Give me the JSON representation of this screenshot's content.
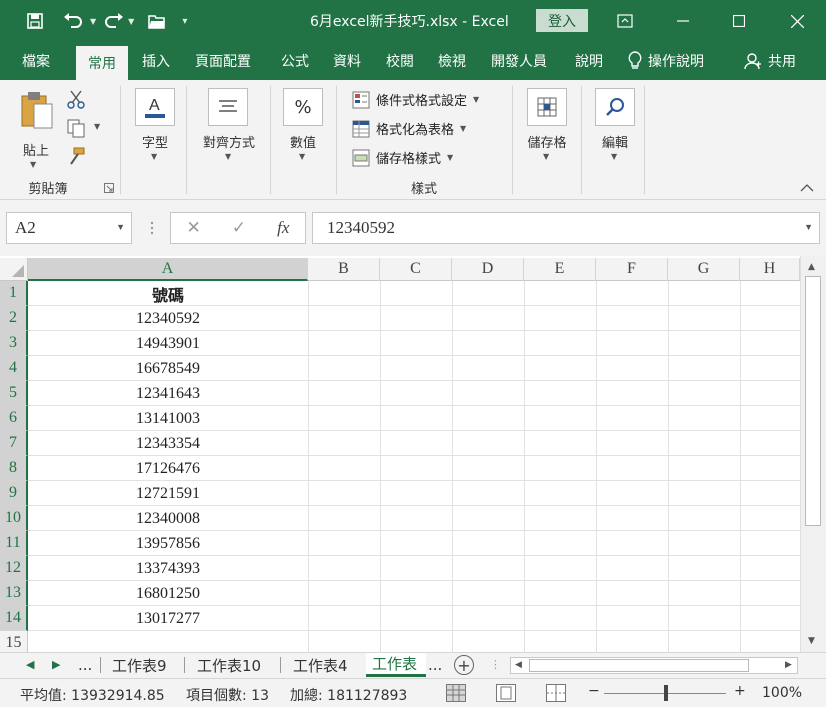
{
  "titlebar": {
    "filename": "6月excel新手技巧.xlsx  -  Excel",
    "login_label": "登入",
    "save_icon": "save-icon",
    "undo_icon": "undo-icon",
    "redo_icon": "redo-icon",
    "open_icon": "open-folder-icon"
  },
  "tabs": [
    "檔案",
    "常用",
    "插入",
    "頁面配置",
    "公式",
    "資料",
    "校閱",
    "檢視",
    "開發人員",
    "說明"
  ],
  "active_tab": "常用",
  "tell_me": "操作說明",
  "share": "共用",
  "ribbon": {
    "clipboard": {
      "paste": "貼上",
      "group": "剪貼簿"
    },
    "font": {
      "label": "字型"
    },
    "alignment": {
      "label": "對齊方式"
    },
    "number": {
      "label": "數值",
      "symbol": "%"
    },
    "styles": {
      "conditional": "條件式格式設定",
      "as_table": "格式化為表格",
      "cell_styles": "儲存格樣式",
      "group": "樣式"
    },
    "cells": {
      "label": "儲存格"
    },
    "editing": {
      "label": "編輯"
    }
  },
  "formula_bar": {
    "name_box": "A2",
    "fx": "fx",
    "value": "12340592"
  },
  "grid": {
    "columns": [
      "A",
      "B",
      "C",
      "D",
      "E",
      "F",
      "G",
      "H"
    ],
    "rows": [
      "1",
      "2",
      "3",
      "4",
      "5",
      "6",
      "7",
      "8",
      "9",
      "10",
      "11",
      "12",
      "13",
      "14",
      "15"
    ],
    "colA": [
      "號碼",
      "12340592",
      "14943901",
      "16678549",
      "12341643",
      "13141003",
      "12343354",
      "17126476",
      "12721591",
      "12340008",
      "13957856",
      "13374393",
      "16801250",
      "13017277",
      ""
    ]
  },
  "sheets": {
    "ellipsis": "...",
    "tab1": "工作表9",
    "tab2": "工作表10",
    "tab3": "工作表4",
    "active": "工作表",
    "more": "..."
  },
  "status": {
    "average": "平均值: 13932914.85",
    "count": "項目個數: 13",
    "sum": "加總: 181127893",
    "zoom": "100%",
    "zoom_level": 1.0
  },
  "colors": {
    "accent": "#217346",
    "ribbon_bg": "#f3f3f3"
  }
}
